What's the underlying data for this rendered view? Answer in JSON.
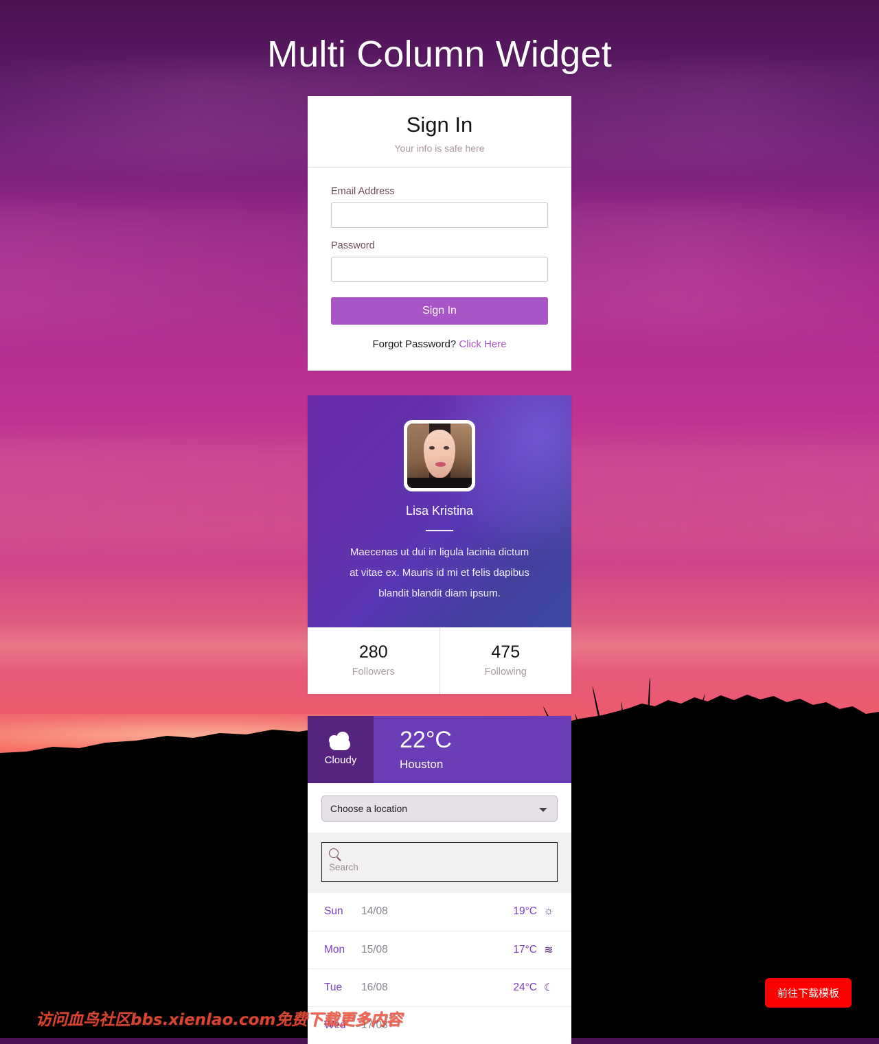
{
  "page": {
    "title": "Multi Column Widget"
  },
  "signin": {
    "title": "Sign In",
    "subtitle": "Your info is safe here",
    "email_label": "Email Address",
    "email_value": "",
    "email_placeholder": "",
    "password_label": "Password",
    "password_value": "",
    "password_placeholder": "",
    "submit_label": "Sign In",
    "forgot_text": "Forgot Password?",
    "forgot_link_label": "Click Here",
    "accent_color": "#a855c8"
  },
  "profile": {
    "name": "Lisa Kristina",
    "bio": "Maecenas ut dui in ligula lacinia dictum at vitae ex. Mauris id mi et felis dapibus blandit blandit diam ipsum.",
    "avatar_alt": "avatar-photo",
    "stats": [
      {
        "value": "280",
        "label": "Followers"
      },
      {
        "value": "475",
        "label": "Following"
      }
    ]
  },
  "weather": {
    "condition": "Cloudy",
    "condition_icon": "cloud-icon",
    "temperature": "22°C",
    "city": "Houston",
    "location_select_value": "Choose a location",
    "location_options": [
      "Choose a location"
    ],
    "search_placeholder": "Search",
    "search_value": "",
    "search_icon": "search-icon",
    "header_dark_color": "#56237f",
    "header_light_color": "#6a3cb5",
    "forecast": [
      {
        "day": "Sun",
        "date": "14/08",
        "temp": "19°C",
        "icon": "☼",
        "icon_name": "sun-icon"
      },
      {
        "day": "Mon",
        "date": "15/08",
        "temp": "17°C",
        "icon": "≋",
        "icon_name": "fog-icon"
      },
      {
        "day": "Tue",
        "date": "16/08",
        "temp": "24°C",
        "icon": "☾",
        "icon_name": "moon-icon"
      },
      {
        "day": "Wed",
        "date": "17/08",
        "temp": "",
        "icon": "",
        "icon_name": "partial-row-icon"
      }
    ]
  },
  "overlay": {
    "watermark": "访问血鸟社区bbs.xienlao.com免费下载更多内容",
    "download_label": "前往下载模板",
    "download_color": "#fb0200"
  }
}
